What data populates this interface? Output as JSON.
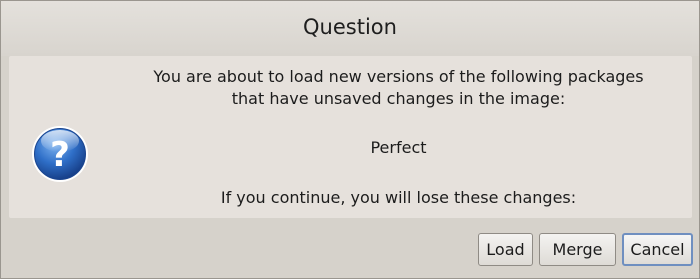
{
  "dialog": {
    "title": "Question",
    "icon": "question-icon",
    "message_line1": "You are about to load new versions of the following packages",
    "message_line2": "that have unsaved changes in the image:",
    "package": "Perfect",
    "warning": "If you continue, you will lose these changes:"
  },
  "buttons": {
    "load_label": "Load",
    "merge_label": "Merge",
    "cancel_label": "Cancel"
  },
  "colors": {
    "icon_blue": "#2f6fc8",
    "focus_border": "#6f8fc0"
  }
}
